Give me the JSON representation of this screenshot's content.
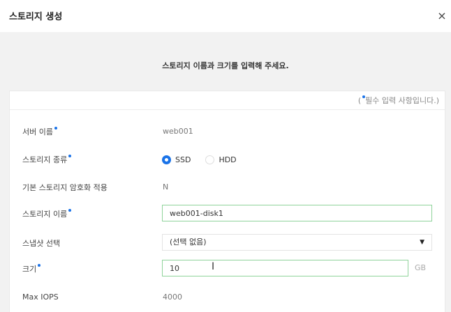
{
  "dialog": {
    "title": "스토리지 생성",
    "close_glyph": "×",
    "subtitle": "스토리지 이름과 크기를 입력해 주세요.",
    "required_note_prefix": "(",
    "required_note_text": "필수 입력 사항입니다.)"
  },
  "fields": {
    "server_name": {
      "label": "서버 이름",
      "value": "web001"
    },
    "storage_type": {
      "label": "스토리지 종류",
      "options": [
        {
          "label": "SSD",
          "checked": true
        },
        {
          "label": "HDD",
          "checked": false
        }
      ]
    },
    "encryption": {
      "label": "기본 스토리지 암호화 적용",
      "value": "N"
    },
    "storage_name": {
      "label": "스토리지 이름",
      "value": "web001-disk1"
    },
    "snapshot": {
      "label": "스냅샷 선택",
      "selected": "(선택 없음)",
      "arrow_glyph": "▼"
    },
    "size": {
      "label": "크기",
      "value": "10",
      "unit": "GB"
    },
    "max_iops": {
      "label": "Max IOPS",
      "value": "4000"
    }
  },
  "colors": {
    "accent": "#1a73e8",
    "input_border": "#8fd39b"
  },
  "icons": {
    "close": "close-icon",
    "dropdown": "chevron-down-icon",
    "cursor": "text-cursor-icon"
  }
}
